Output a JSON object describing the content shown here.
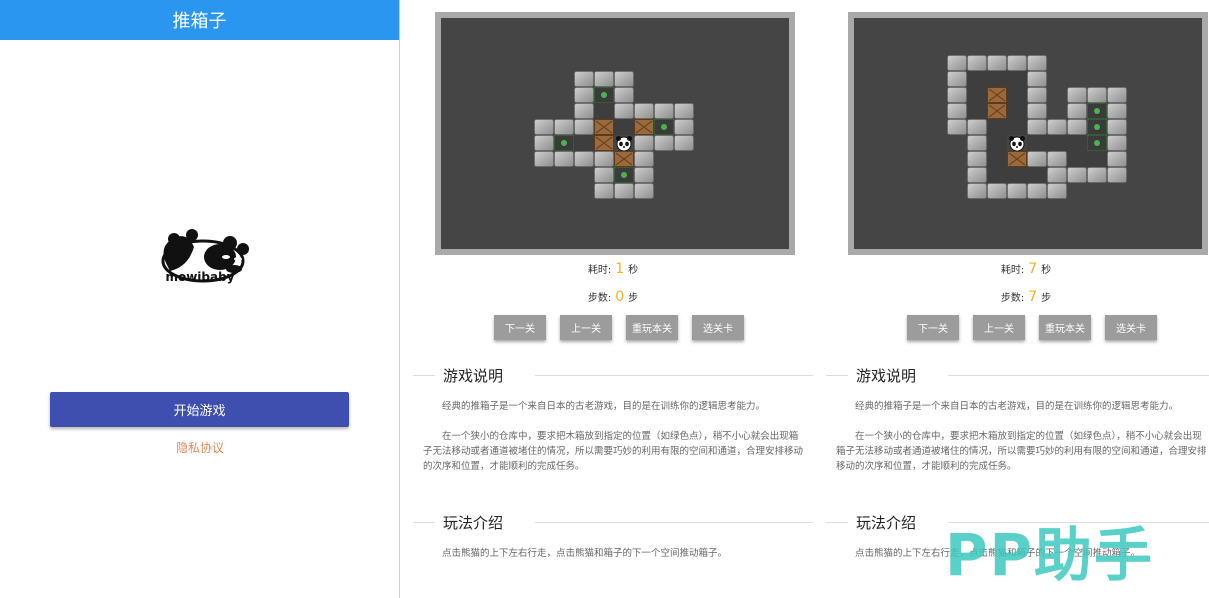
{
  "home": {
    "title": "推箱子",
    "logo_text": "mowibaby",
    "start_button": "开始游戏",
    "privacy_link": "隐私协议"
  },
  "games": [
    {
      "time_label": "耗时:",
      "time_value": "1",
      "time_unit": "秒",
      "steps_label": "步数:",
      "steps_value": "0",
      "steps_unit": "步",
      "buttons": [
        "下一关",
        "上一关",
        "重玩本关",
        "选关卡"
      ],
      "section1_title": "游戏说明",
      "section1_p1": "经典的推箱子是一个来自日本的古老游戏，目的是在训练你的逻辑思考能力。",
      "section1_p2": "在一个狭小的仓库中，要求把木箱放到指定的位置（如绿色点），稍不小心就会出现箱子无法移动或者通道被堵住的情况，所以需要巧妙的利用有限的空间和通道，合理安排移动的次序和位置，才能顺利的完成任务。",
      "section2_title": "玩法介绍",
      "section2_p1": "点击熊猫的上下左右行走，点击熊猫和箱子的下一个空间推动箱子。"
    },
    {
      "time_label": "耗时:",
      "time_value": "7",
      "time_unit": "秒",
      "steps_label": "步数:",
      "steps_value": "7",
      "steps_unit": "步",
      "buttons": [
        "下一关",
        "上一关",
        "重玩本关",
        "选关卡"
      ],
      "section1_title": "游戏说明",
      "section1_p1": "经典的推箱子是一个来自日本的古老游戏，目的是在训练你的逻辑思考能力。",
      "section1_p2": "在一个狭小的仓库中，要求把木箱放到指定的位置（如绿色点），稍不小心就会出现箱子无法移动或者通道被堵住的情况，所以需要巧妙的利用有限的空间和通道，合理安排移动的次序和位置，才能顺利的完成任务。",
      "section2_title": "玩法介绍",
      "section2_p1": "点击熊猫的上下左右行走，点击熊猫和箱子的下一个空间推动箱子。"
    }
  ],
  "watermark": "PP助手",
  "colors": {
    "header_blue": "#2a96ef",
    "start_button": "#3f4fb0",
    "privacy_text": "#e0895a",
    "board_bg": "#454545",
    "stat_highlight": "#f0b020",
    "game_button": "#9c9c9c"
  }
}
